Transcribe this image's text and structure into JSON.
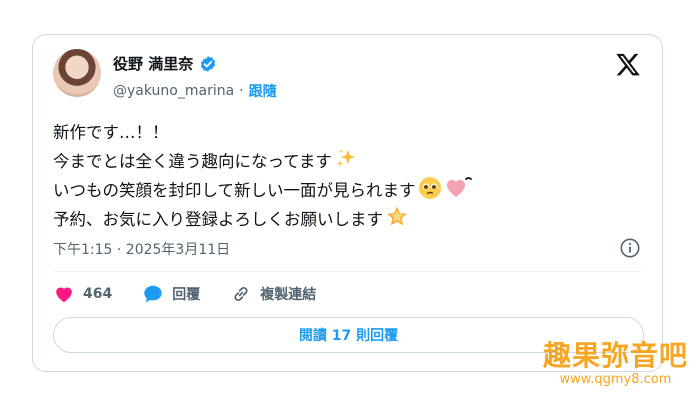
{
  "user": {
    "display_name": "役野 満里奈",
    "handle": "@yakuno_marina",
    "separator": "·",
    "follow_label": "跟隨"
  },
  "tweet": {
    "lines": [
      "新作です…！！",
      "今までとは全く違う趣向になってます",
      "いつもの笑顔を封印して新しい一面が見られます",
      "予約、お気に入り登録よろしくお願いします"
    ],
    "emoji": {
      "line2": "sparkles-icon",
      "line3": [
        "pleading-face-icon",
        "pink-heart-icon"
      ],
      "line4": "glowing-star-icon"
    },
    "timestamp": "下午1:15 · 2025年3月11日"
  },
  "actions": {
    "likes_count": "464",
    "reply_label": "回覆",
    "copy_link_label": "複製連結"
  },
  "read_replies_label": "閱讀 17 則回覆",
  "watermark": {
    "title": "趣果弥音吧",
    "url": "www.qgmy8.com"
  },
  "colors": {
    "accent": "#1d9bf0",
    "like": "#f91880",
    "text": "#0f1419",
    "muted": "#536471",
    "watermark": "#f6a623"
  }
}
